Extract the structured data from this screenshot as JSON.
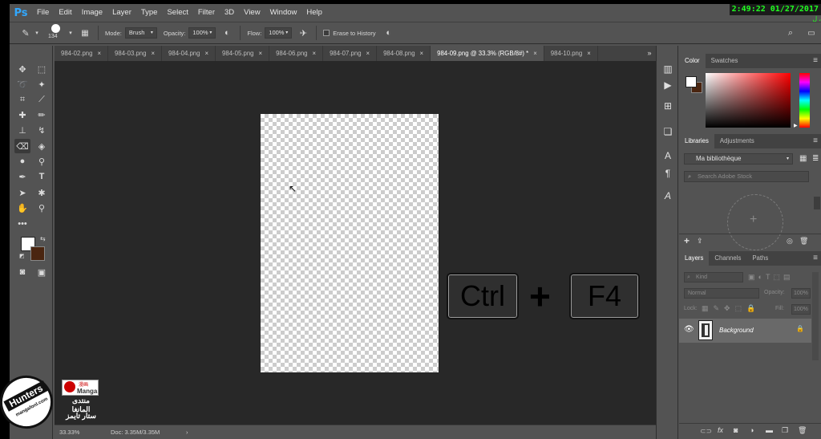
{
  "app": {
    "logo": "Ps"
  },
  "menu": [
    "File",
    "Edit",
    "Image",
    "Layer",
    "Type",
    "Select",
    "Filter",
    "3D",
    "View",
    "Window",
    "Help"
  ],
  "clock": {
    "text": "2:49:22 01/27/2017",
    "extra": "ل ،"
  },
  "options": {
    "brush_size": "134",
    "mode_label": "Mode:",
    "mode_value": "Brush",
    "opacity_label": "Opacity:",
    "opacity_value": "100%",
    "flow_label": "Flow:",
    "flow_value": "100%",
    "erase_history_label": "Erase to History"
  },
  "tabs": [
    {
      "label": "984-02.png",
      "active": false
    },
    {
      "label": "984-03.png",
      "active": false
    },
    {
      "label": "984-04.png",
      "active": false
    },
    {
      "label": "984-05.png",
      "active": false
    },
    {
      "label": "984-06.png",
      "active": false
    },
    {
      "label": "984-07.png",
      "active": false
    },
    {
      "label": "984-08.png",
      "active": false
    },
    {
      "label": "984-09.png @ 33.3% (RGB/8#) *",
      "active": true
    },
    {
      "label": "984-10.png",
      "active": false
    }
  ],
  "tab_close": "×",
  "tab_overflow": "»",
  "keys": {
    "ctrl": "Ctrl",
    "plus": "+",
    "f4": "F4"
  },
  "status": {
    "zoom": "33.33%",
    "doc": "Doc: 3.35M/3.35M",
    "arrow": "›"
  },
  "color_panel": {
    "tabs": [
      "Color",
      "Swatches"
    ],
    "fg_color": "#ffffff",
    "bg_color": "#4a2510"
  },
  "libraries_panel": {
    "tabs": [
      "Libraries",
      "Adjustments"
    ],
    "library_name": "Ma bibliothèque",
    "search_placeholder": "Search Adobe Stock",
    "add_symbol": "+"
  },
  "layers_panel": {
    "tabs": [
      "Layers",
      "Channels",
      "Paths"
    ],
    "kind_label": "Kind",
    "blend_mode": "Normal",
    "opacity_label": "Opacity:",
    "opacity_value": "100%",
    "lock_label": "Lock:",
    "fill_label": "Fill:",
    "fill_value": "100%",
    "layer_name": "Background",
    "footer_fx": "fx"
  },
  "watermark": {
    "badge_top": "Hunters",
    "badge_bottom": "mangafonl.com",
    "line1": "Manga",
    "line2": "منتدى المانغا",
    "line3": "ستار تايمز",
    "logo_small": "漫画"
  }
}
